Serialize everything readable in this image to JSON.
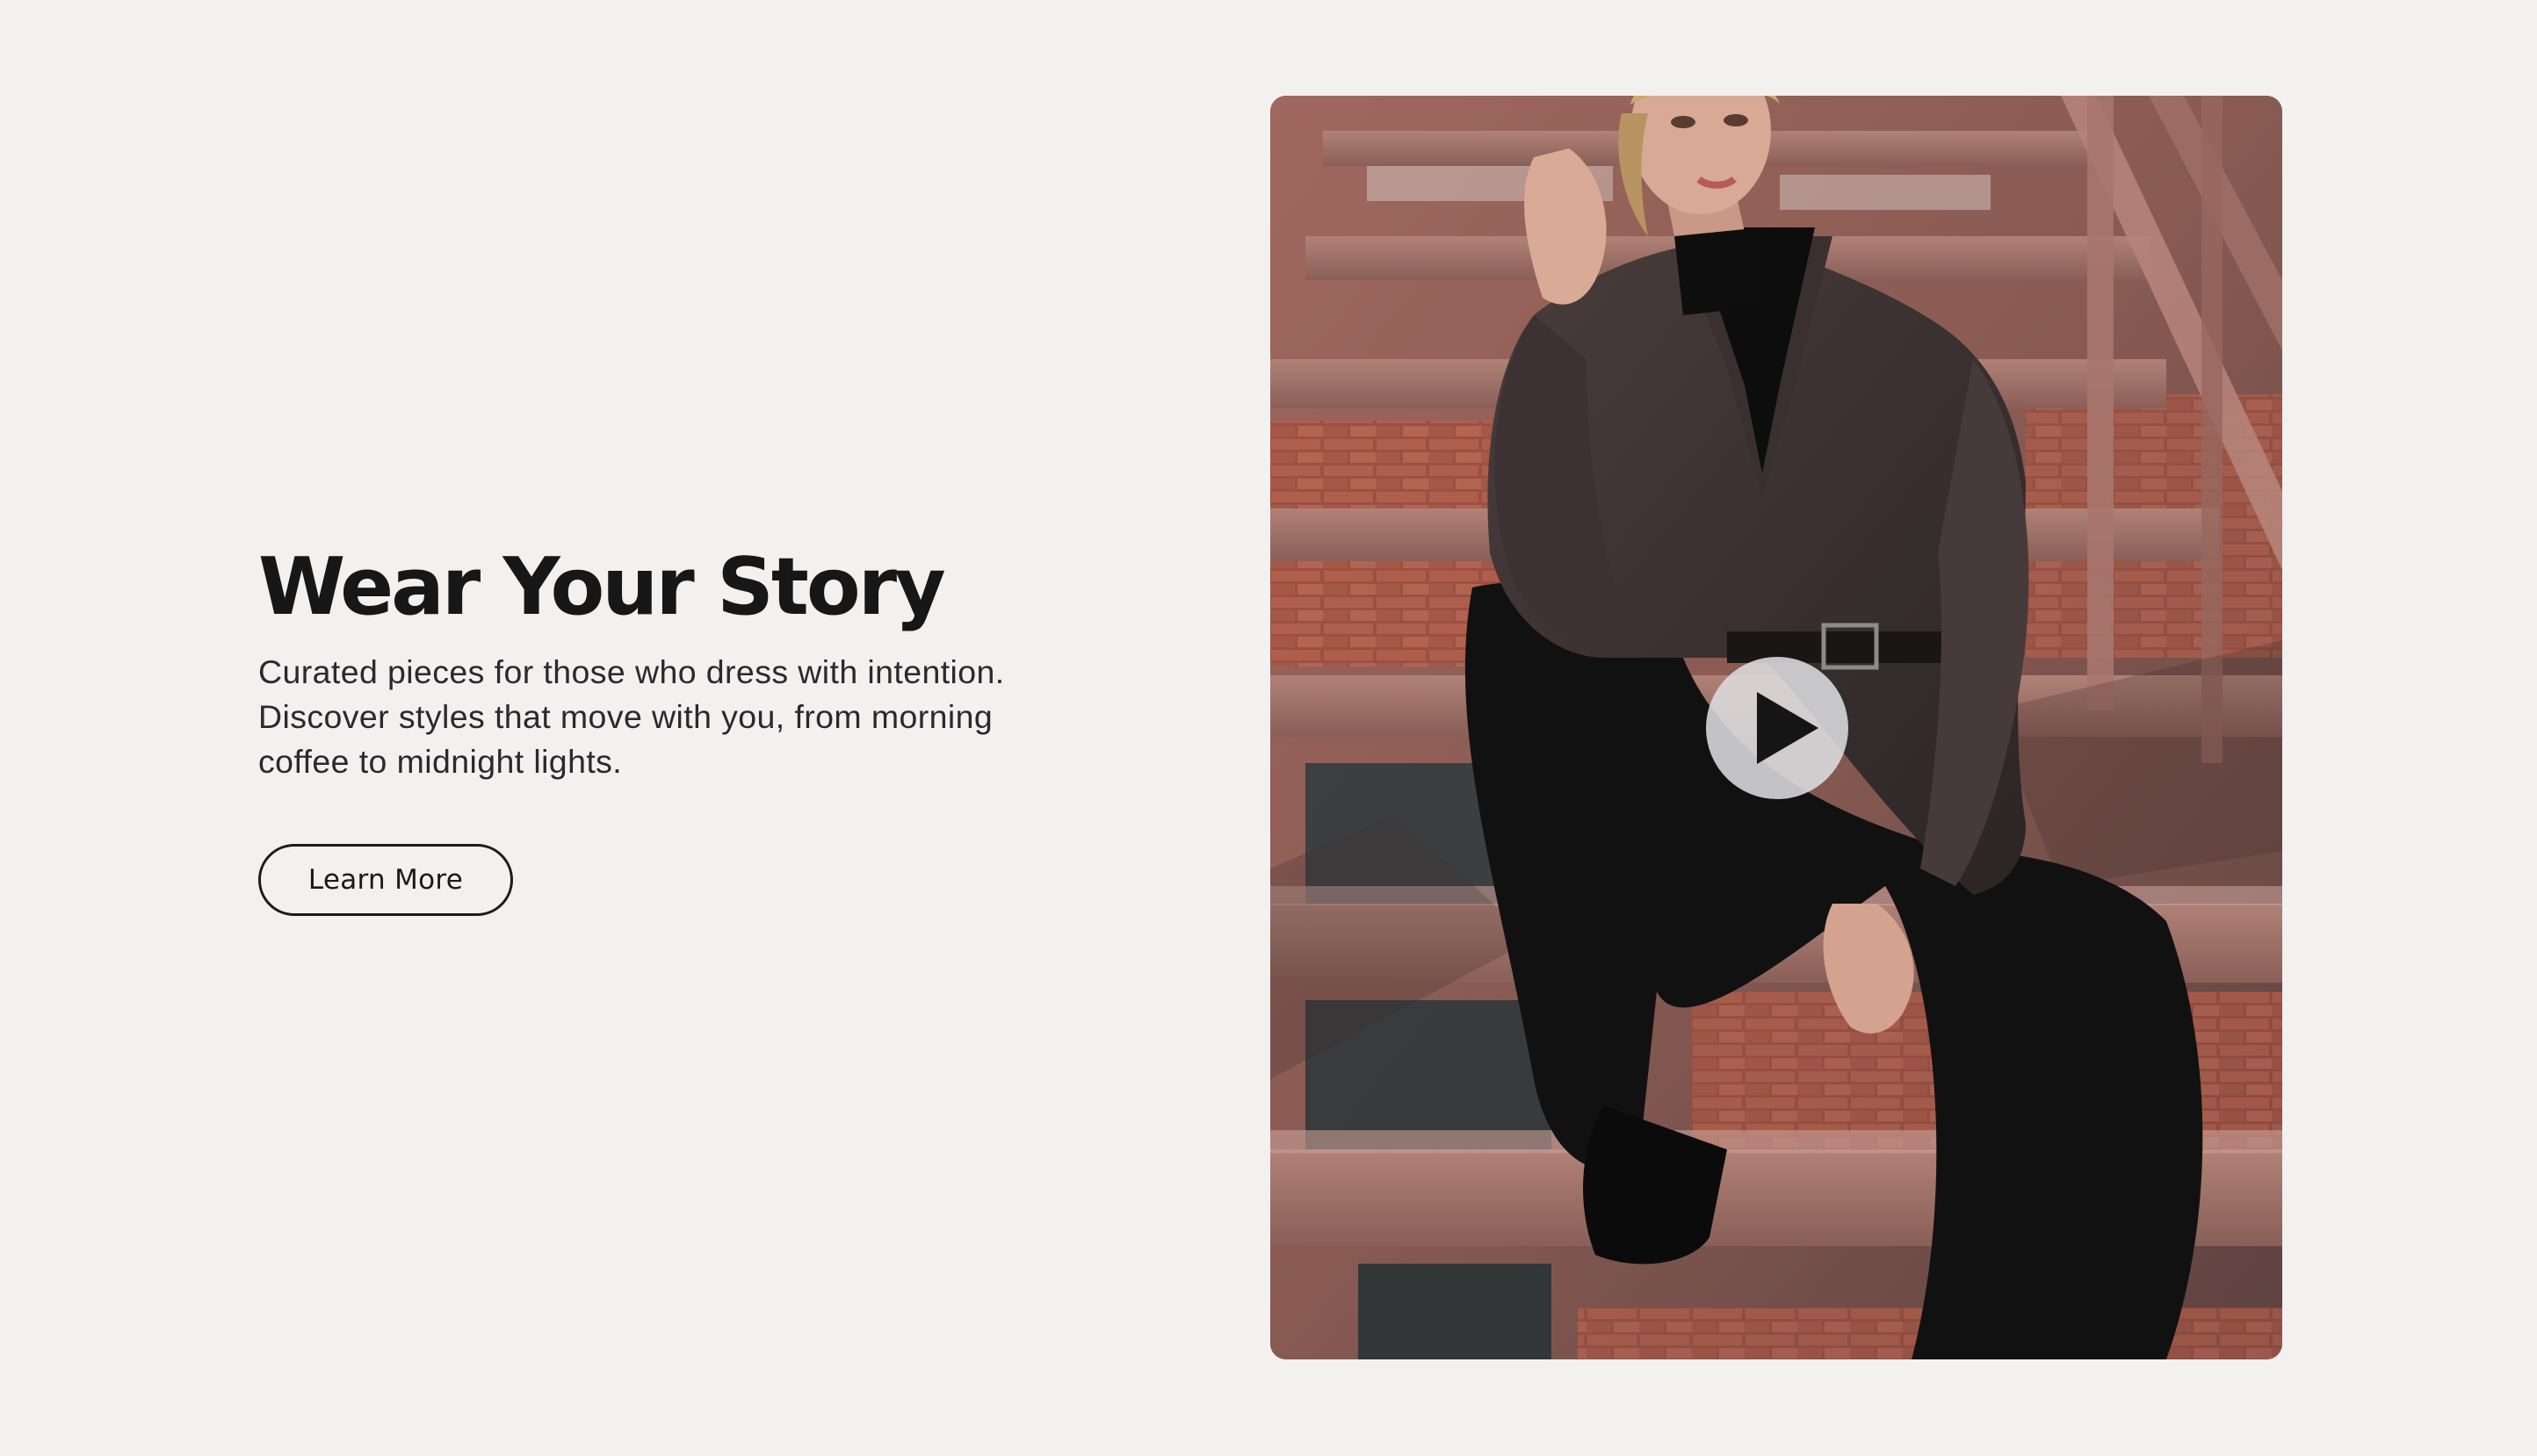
{
  "hero": {
    "title": "Wear Your Story",
    "description": "Curated pieces for those who dress with intention. Discover styles that move with you, from morning coffee to midnight lights.",
    "cta_label": "Learn More"
  },
  "video": {
    "play_icon": "play-icon"
  },
  "colors": {
    "background": "#f3f0f0",
    "text_primary": "#171717",
    "text_secondary": "#2a2a2e",
    "play_button": "#dcdcde"
  }
}
